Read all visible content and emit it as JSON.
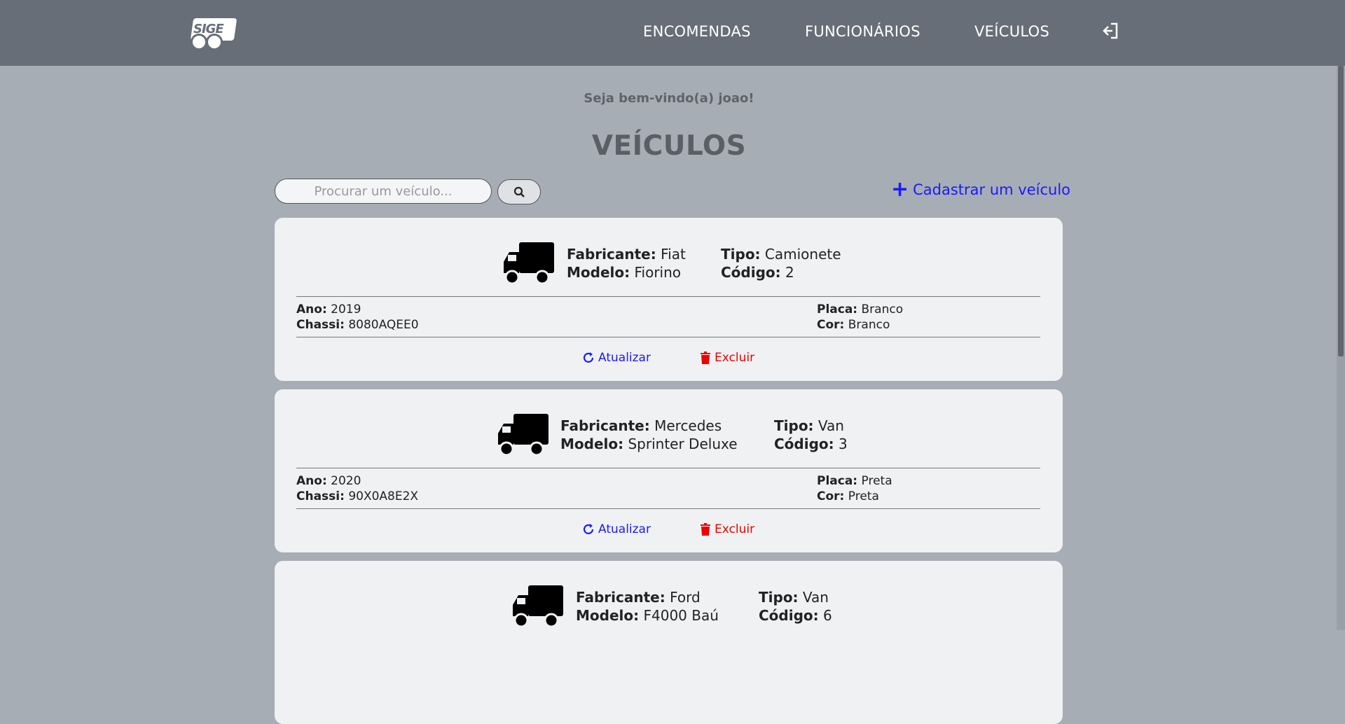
{
  "header": {
    "logo_text": "SIGE",
    "nav": [
      "ENCOMENDAS",
      "FUNCIONÁRIOS",
      "VEÍCULOS"
    ],
    "logout_icon": "sign-out-icon"
  },
  "welcome": "Seja bem-vindo(a) joao!",
  "title": "VEÍCULOS",
  "search": {
    "placeholder": "Procurar um veículo...",
    "icon": "search-icon"
  },
  "add_label": "Cadastrar um veículo",
  "labels": {
    "fabricante": "Fabricante:",
    "modelo": "Modelo:",
    "tipo": "Tipo:",
    "codigo": "Código:",
    "ano": "Ano:",
    "chassi": "Chassi:",
    "placa": "Placa:",
    "cor": "Cor:",
    "atualizar": "Atualizar",
    "excluir": "Excluir"
  },
  "vehicles": [
    {
      "fabricante": "Fiat",
      "modelo": "Fiorino",
      "tipo": "Camionete",
      "codigo": "2",
      "ano": "2019",
      "chassi": "8080AQEE0",
      "placa": "Branco",
      "cor": "Branco"
    },
    {
      "fabricante": "Mercedes",
      "modelo": "Sprinter Deluxe",
      "tipo": "Van",
      "codigo": "3",
      "ano": "2020",
      "chassi": "90X0A8E2X",
      "placa": "Preta",
      "cor": "Preta"
    },
    {
      "fabricante": "Ford",
      "modelo": "F4000 Baú",
      "tipo": "Van",
      "codigo": "6"
    }
  ],
  "colors": {
    "header": "#686e77",
    "background": "#a7adb5",
    "card": "#f0f1f2",
    "link": "#1a1aff",
    "danger": "#e00000"
  }
}
